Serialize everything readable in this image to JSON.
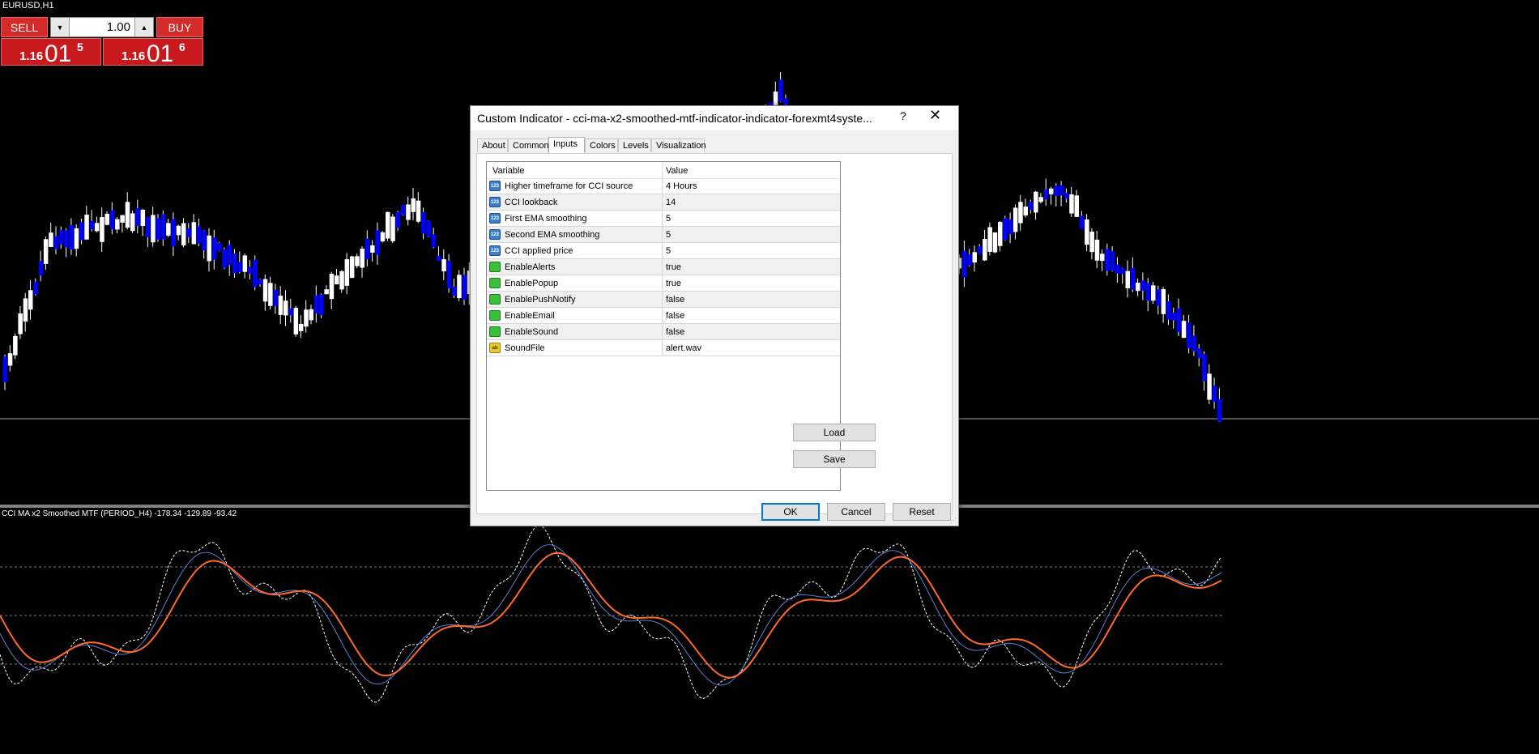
{
  "chart": {
    "symbol": "EURUSD,H1",
    "indicator_label": "CCI MA x2 Smoothed MTF (PERIOD_H4) -178.34 -129.89 -93.42",
    "colors": {
      "background": "#000000",
      "bull_candle": "#ffffff",
      "bear_candle": "#0000ff",
      "ema_slow": "#ff6a2a",
      "ema_fast": "#5b7fd0",
      "cci": "#ffffff"
    }
  },
  "trade_panel": {
    "sell_label": "SELL",
    "buy_label": "BUY",
    "lot_value": "1.00",
    "bid": {
      "small": "1.16",
      "big": "01",
      "sup": "5"
    },
    "ask": {
      "small": "1.16",
      "big": "01",
      "sup": "6"
    }
  },
  "dialog": {
    "title": "Custom Indicator - cci-ma-x2-smoothed-mtf-indicator-indicator-forexmt4syste...",
    "help": "?",
    "close": "✕",
    "tabs": [
      "About",
      "Common",
      "Inputs",
      "Colors",
      "Levels",
      "Visualization"
    ],
    "active_tab": "Inputs",
    "grid": {
      "header": {
        "variable": "Variable",
        "value": "Value"
      },
      "rows": [
        {
          "icon": "123",
          "variable": "Higher timeframe for CCI source",
          "value": "4 Hours"
        },
        {
          "icon": "123",
          "variable": "CCI lookback",
          "value": "14"
        },
        {
          "icon": "123",
          "variable": "First EMA smoothing",
          "value": "5"
        },
        {
          "icon": "123",
          "variable": "Second EMA smoothing",
          "value": "5"
        },
        {
          "icon": "123",
          "variable": "CCI applied price",
          "value": "5"
        },
        {
          "icon": "bool",
          "variable": "EnableAlerts",
          "value": "true"
        },
        {
          "icon": "bool",
          "variable": "EnablePopup",
          "value": "true"
        },
        {
          "icon": "bool",
          "variable": "EnablePushNotify",
          "value": "false"
        },
        {
          "icon": "bool",
          "variable": "EnableEmail",
          "value": "false"
        },
        {
          "icon": "bool",
          "variable": "EnableSound",
          "value": "false"
        },
        {
          "icon": "ab",
          "variable": "SoundFile",
          "value": "alert.wav"
        }
      ]
    },
    "buttons": {
      "load": "Load",
      "save": "Save",
      "ok": "OK",
      "cancel": "Cancel",
      "reset": "Reset"
    }
  }
}
